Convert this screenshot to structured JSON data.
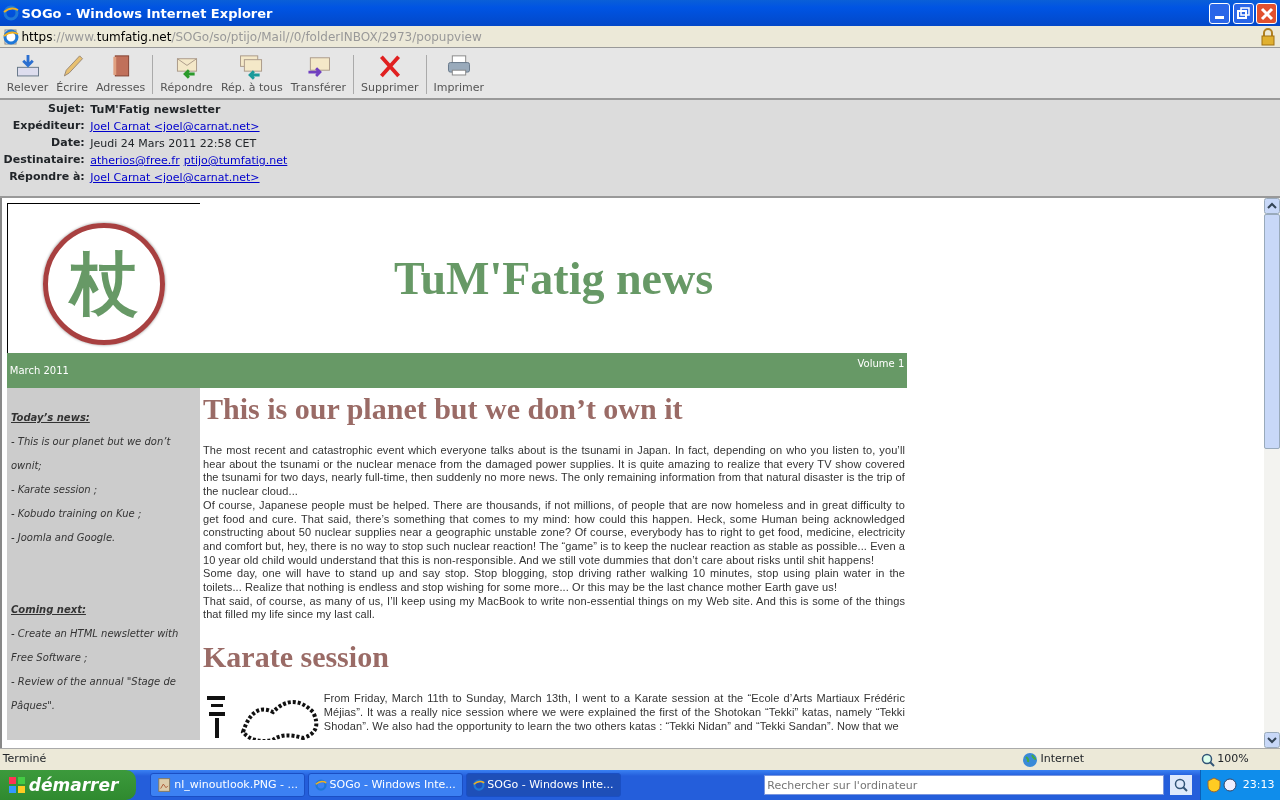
{
  "window": {
    "title": "SOGo - Windows Internet Explorer"
  },
  "address": [
    {
      "text": "https",
      "emphasis": true
    },
    {
      "text": "://www.",
      "emphasis": false
    },
    {
      "text": "tumfatig.net",
      "emphasis": true
    },
    {
      "text": "/SOGo/so/ptijo/Mail//0/folderINBOX/2973/popupview",
      "emphasis": false
    }
  ],
  "toolbar": [
    [
      {
        "label": "Relever",
        "kind": "get"
      },
      {
        "label": "Écrire",
        "kind": "write"
      },
      {
        "label": "Adresses",
        "kind": "book"
      }
    ],
    [
      {
        "label": "Répondre",
        "kind": "reply"
      },
      {
        "label": "Rép. à tous",
        "kind": "replyall"
      },
      {
        "label": "Transférer",
        "kind": "forward"
      }
    ],
    [
      {
        "label": "Supprimer",
        "kind": "delete"
      }
    ],
    [
      {
        "label": "Imprimer",
        "kind": "print"
      }
    ]
  ],
  "headers": [
    {
      "label": "Sujet:",
      "kind": "subject",
      "values": [
        "TuM'Fatig newsletter"
      ]
    },
    {
      "label": "Expéditeur:",
      "kind": "links",
      "values": [
        "Joel Carnat <joel@carnat.net>"
      ]
    },
    {
      "label": "Date:",
      "kind": "text",
      "values": [
        "Jeudi 24 Mars 2011 22:58 CET"
      ]
    },
    {
      "label": "Destinataire:",
      "kind": "links",
      "values": [
        "atherios@free.fr",
        "ptijo@tumfatig.net"
      ]
    },
    {
      "label": "Répondre à:",
      "kind": "links",
      "values": [
        "Joel Carnat <joel@carnat.net>"
      ]
    }
  ],
  "newsletter": {
    "logo_character": "杖",
    "title": "TuM'Fatig news",
    "date": "March 2011",
    "volume": "Volume 1",
    "sidebar": [
      {
        "heading": "Today’s news:",
        "items": [
          "- This is our planet but we don’t ownit;",
          "- Karate session ;",
          "- Kobudo training on Kue ;",
          "- Joomla and Google."
        ]
      },
      {
        "heading": "Coming next:",
        "items": [
          "- Create an HTML newsletter with Free Software ;",
          "- Review of the annual \"Stage de Pâques\"."
        ]
      }
    ],
    "articles": [
      {
        "title": "This is our planet but we don’t own it",
        "image": false,
        "paragraphs": [
          "The most recent and catastrophic event which everyone talks about is the tsunami in Japan. In fact, depending on who you listen to, you’ll hear about the tsunami or the nuclear menace from the damaged power supplies. It is quite amazing to realize that every TV show covered the tsunami for two days, nearly full-time, then suddenly no more news. The only remaining information from that natural disaster is the trip of the nuclear cloud...",
          "Of course, Japanese people must be helped. There are thousands, if not millions, of people that are now homeless and in great difficulty to get food and cure. That said, there’s something that comes to my mind: how could this happen. Heck, some Human being acknowledged constructing about 50 nuclear supplies near a geographic unstable zone? Of course, everybody has to right to get food, medicine, electricity and comfort but, hey, there is no way to stop such nuclear reaction! The “game” is to keep the nuclear reaction as stable as possible... Even a 10 year old child would understand that this is non-responsible. And we still vote dummies that don’t care about risks until shit happens!",
          "Some day, one will have to stand up and say stop. Stop blogging, stop driving rather walking 10 minutes, stop using plain water in the toilets... Realize that nothing is endless and stop wishing for some more... Or this may be the last chance mother Earth gave us!",
          "That said, of course, as many of us, I’ll keep using my MacBook to write non-essential things on my Web site. And this is some of the things that filled my life since my last call."
        ]
      },
      {
        "title": "Karate session",
        "image": true,
        "paragraphs": [
          "From Friday, March 11th to Sunday, March 13th, I went to a Karate session at the “Ecole d’Arts Martiaux Frédéric Méjias”. It was a really nice session where we were explained the first of the Shotokan “Tekki” katas, namely “Tekki Shodan”. We also had the opportunity to learn the two others katas : “Tekki Nidan” and “Tekki Sandan”. Now that we"
        ]
      }
    ]
  },
  "status_bar": {
    "text": "Terminé",
    "zone": "Internet",
    "zoom": "100%"
  },
  "taskbar": {
    "start": "démarrer",
    "tasks": [
      {
        "label": "nl_winoutlook.PNG - ...",
        "kind": "image",
        "selected": false
      },
      {
        "label": "SOGo - Windows Inte...",
        "kind": "ie",
        "selected": false
      },
      {
        "label": "SOGo - Windows Inte...",
        "kind": "ie",
        "selected": true
      }
    ],
    "search_placeholder": "Rechercher sur l'ordinateur",
    "clock": "23:13"
  }
}
